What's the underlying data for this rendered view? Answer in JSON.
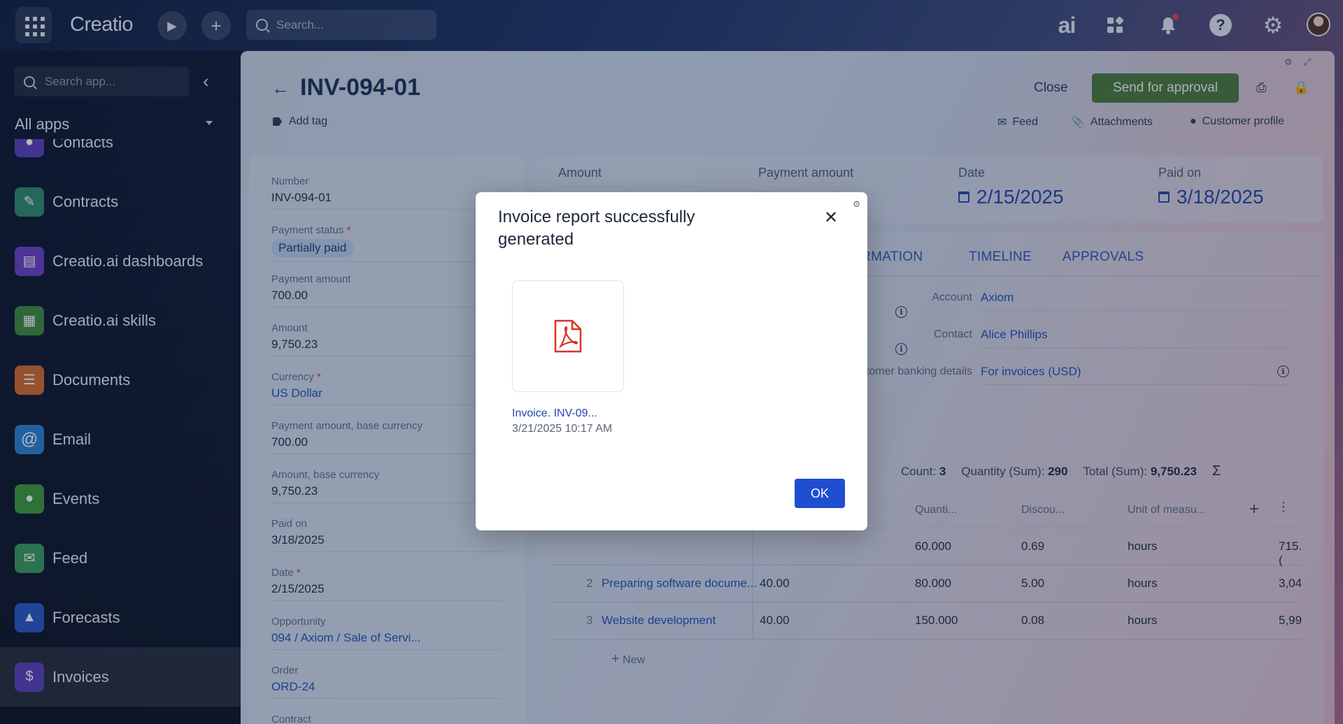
{
  "topbar": {
    "logo": "Creatio",
    "search_placeholder": "Search...",
    "ai_label": "ai"
  },
  "sidebar": {
    "search_placeholder": "Search app...",
    "section_title": "All apps",
    "items": [
      {
        "label": "Contacts",
        "icon": "contacts-icon",
        "color": "#5a3fb8"
      },
      {
        "label": "Contracts",
        "icon": "contracts-icon",
        "color": "#2f8a6a"
      },
      {
        "label": "Creatio.ai dashboards",
        "icon": "dashboards-icon",
        "color": "#6a3fc4"
      },
      {
        "label": "Creatio.ai skills",
        "icon": "skills-icon",
        "color": "#3b8a3c"
      },
      {
        "label": "Documents",
        "icon": "documents-icon",
        "color": "#d26a2a"
      },
      {
        "label": "Email",
        "icon": "email-icon",
        "color": "#2a7fd2"
      },
      {
        "label": "Events",
        "icon": "events-icon",
        "color": "#3c9a3a"
      },
      {
        "label": "Feed",
        "icon": "feed-icon",
        "color": "#3a9a5a"
      },
      {
        "label": "Forecasts",
        "icon": "forecasts-icon",
        "color": "#2a56c4"
      },
      {
        "label": "Invoices",
        "icon": "invoices-icon",
        "color": "#5a3fb8"
      }
    ]
  },
  "header": {
    "title": "INV-094-01",
    "add_tag": "Add tag",
    "close": "Close",
    "send_for_approval": "Send for approval",
    "links": [
      "Feed",
      "Attachments",
      "Customer profile"
    ]
  },
  "fields": [
    {
      "label": "Number",
      "value": "INV-094-01",
      "required": false,
      "type": "text"
    },
    {
      "label": "Payment status",
      "value": "Partially paid",
      "required": true,
      "type": "pill"
    },
    {
      "label": "Payment amount",
      "value": "700.00",
      "required": false,
      "type": "text"
    },
    {
      "label": "Amount",
      "value": "9,750.23",
      "required": false,
      "type": "text"
    },
    {
      "label": "Currency",
      "value": "US Dollar",
      "required": true,
      "type": "link"
    },
    {
      "label": "Payment amount, base currency",
      "value": "700.00",
      "required": false,
      "type": "text"
    },
    {
      "label": "Amount, base currency",
      "value": "9,750.23",
      "required": false,
      "type": "text"
    },
    {
      "label": "Paid on",
      "value": "3/18/2025",
      "required": false,
      "type": "text"
    },
    {
      "label": "Date",
      "value": "2/15/2025",
      "required": true,
      "type": "text"
    },
    {
      "label": "Opportunity",
      "value": "094 / Axiom / Sale of Servi...",
      "required": false,
      "type": "link"
    },
    {
      "label": "Order",
      "value": "ORD-24",
      "required": false,
      "type": "link"
    },
    {
      "label": "Contract",
      "value": "",
      "required": false,
      "type": "text"
    }
  ],
  "stats": {
    "amount_label": "Amount",
    "payment_amount_label": "Payment amount",
    "date_label": "Date",
    "date_value": "2/15/2025",
    "paid_on_label": "Paid on",
    "paid_on_value": "3/18/2025"
  },
  "tabs": [
    "ORMATION",
    "TIMELINE",
    "APPROVALS"
  ],
  "properties": {
    "account_label": "Account",
    "account_value": "Axiom",
    "contact_label": "Contact",
    "contact_value": "Alice Phillips",
    "banking_label": "Customer banking details",
    "banking_value": "For invoices (USD)"
  },
  "summary": {
    "count_label": "Count:",
    "count_value": "3",
    "qty_label": "Quantity (Sum):",
    "qty_value": "290",
    "total_label": "Total (Sum):",
    "total_value": "9,750.23",
    "sigma": "Σ"
  },
  "table": {
    "columns": [
      "Quanti...",
      "Discou...",
      "Unit of measu..."
    ],
    "rows": [
      {
        "num": "",
        "product": "",
        "price": "",
        "quantity": "60.000",
        "discount": "0.69",
        "unit": "hours",
        "total": "715.("
      },
      {
        "num": "2",
        "product": "Preparing software docume...",
        "price": "40.00",
        "quantity": "80.000",
        "discount": "5.00",
        "unit": "hours",
        "total": "3,04"
      },
      {
        "num": "3",
        "product": "Website development",
        "price": "40.00",
        "quantity": "150.000",
        "discount": "0.08",
        "unit": "hours",
        "total": "5,99"
      }
    ],
    "new_label": "New"
  },
  "modal": {
    "title": "Invoice report successfully generated",
    "file_name": "Invoice. INV-09...",
    "file_date": "3/21/2025 10:17 AM",
    "ok": "OK"
  }
}
